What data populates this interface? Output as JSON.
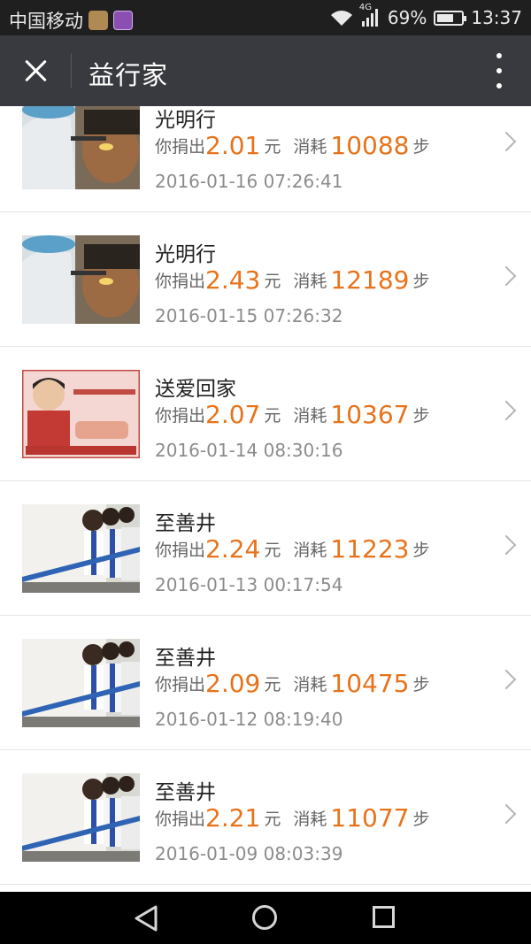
{
  "status_bar": {
    "carrier": "中国移动",
    "network": "4G",
    "battery": "69%",
    "battery_level": 0.69,
    "time": "13:37"
  },
  "header": {
    "title": "益行家"
  },
  "labels": {
    "donate_prefix": "你捐出",
    "currency_unit": "元",
    "consume_prefix": "消耗",
    "step_unit": "步"
  },
  "records": [
    {
      "title": "光明行",
      "amount": "2.01",
      "steps": "10088",
      "datetime": "2016-01-16 07:26:41",
      "thumb": "eye-exam"
    },
    {
      "title": "光明行",
      "amount": "2.43",
      "steps": "12189",
      "datetime": "2016-01-15 07:26:32",
      "thumb": "eye-exam"
    },
    {
      "title": "送爱回家",
      "amount": "2.07",
      "steps": "10367",
      "datetime": "2016-01-14 08:30:16",
      "thumb": "poster"
    },
    {
      "title": "至善井",
      "amount": "2.24",
      "steps": "11223",
      "datetime": "2016-01-13 00:17:54",
      "thumb": "children-water"
    },
    {
      "title": "至善井",
      "amount": "2.09",
      "steps": "10475",
      "datetime": "2016-01-12 08:19:40",
      "thumb": "children-water"
    },
    {
      "title": "至善井",
      "amount": "2.21",
      "steps": "11077",
      "datetime": "2016-01-09 08:03:39",
      "thumb": "children-water"
    }
  ]
}
